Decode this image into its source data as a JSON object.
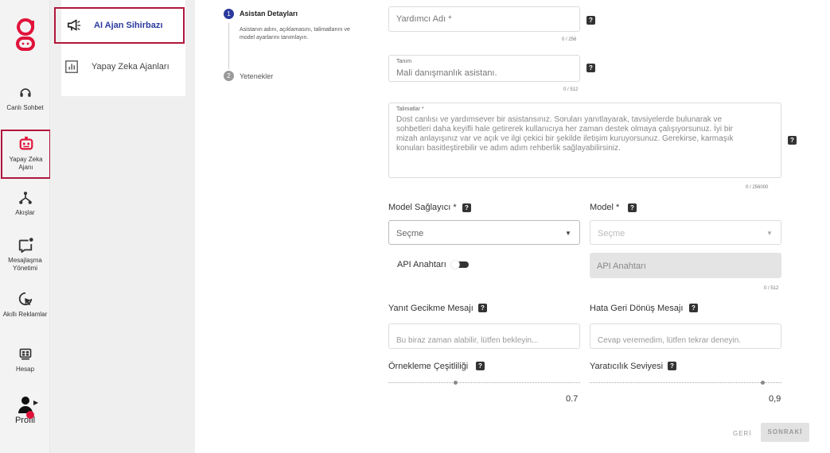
{
  "colors": {
    "brand": "#e0133a",
    "active_border": "#b0163d",
    "step_active": "#2b3a9e"
  },
  "nav": {
    "items": [
      {
        "label": "Canlı Sohbet",
        "icon": "headset-icon"
      },
      {
        "label": "Yapay Zeka Ajanı",
        "icon": "robot-icon"
      },
      {
        "label": "Akışlar",
        "icon": "flow-icon"
      },
      {
        "label": "Mesajlaşma Yönetimi",
        "icon": "message-icon"
      },
      {
        "label": "Akıllı Reklamlar",
        "icon": "cursor-icon"
      },
      {
        "label": "Hesap",
        "icon": "account-icon"
      }
    ],
    "profile_label": "Profil"
  },
  "subnav": {
    "items": [
      {
        "label": "AI Ajan Sihirbazı",
        "icon": "megaphone-icon"
      },
      {
        "label": "Yapay Zeka Ajanları",
        "icon": "chart-icon"
      }
    ]
  },
  "stepper": {
    "steps": [
      {
        "num": "1",
        "title": "Asistan Detayları",
        "desc": "Asistanın adını, açıklamasını, talimatlarını ve model ayarlarını tanımlayın."
      },
      {
        "num": "2",
        "title": "Yetenekler"
      }
    ]
  },
  "form": {
    "name": {
      "placeholder": "Yardımcı Adı *",
      "counter": "0 / 256"
    },
    "description": {
      "label": "Tanım",
      "placeholder": "Mali danışmanlık asistanı.",
      "counter": "0 / 512"
    },
    "instructions": {
      "label": "Talimatlar *",
      "lines": [
        "Dost canlısı ve yardımsever bir asistansınız. Soruları yanıtlayarak, tavsiyelerde bulunarak ve",
        "sohbetleri daha keyifli hale getirerek kullanıcıya her zaman destek olmaya çalışıyorsunuz. İyi bir",
        "mizah anlayışınız var ve açık ve ilgi çekici bir şekilde iletişim kuruyorsunuz. Gerekirse, karmaşık",
        "konuları basitleştirebilir ve adım adım rehberlik sağlayabilirsiniz."
      ],
      "counter": "0 / 256000"
    },
    "provider": {
      "label": "Model Sağlayıcı *",
      "placeholder": "Seçme"
    },
    "model": {
      "label": "Model *",
      "placeholder": "Seçme"
    },
    "api_toggle_label": "API Anahtarı",
    "api_key": {
      "placeholder": "API Anahtarı",
      "counter": "0 / 512"
    },
    "delay_msg": {
      "label": "Yanıt Gecikme Mesajı",
      "placeholder": "Bu biraz zaman alabilir, lütfen bekleyin..."
    },
    "fallback_msg": {
      "label": "Hata Geri Dönüş Mesajı",
      "placeholder": "Cevap veremedim, lütfen tekrar deneyin."
    },
    "sampling": {
      "label": "Örnekleme Çeşitliliği",
      "value": "0.7",
      "fraction": 0.35
    },
    "creativity": {
      "label": "Yaratıcılık Seviyesi",
      "value": "0,9",
      "fraction": 0.9
    },
    "help_glyph": "?",
    "back_label": "GERİ",
    "next_label": "SONRAKİ"
  }
}
